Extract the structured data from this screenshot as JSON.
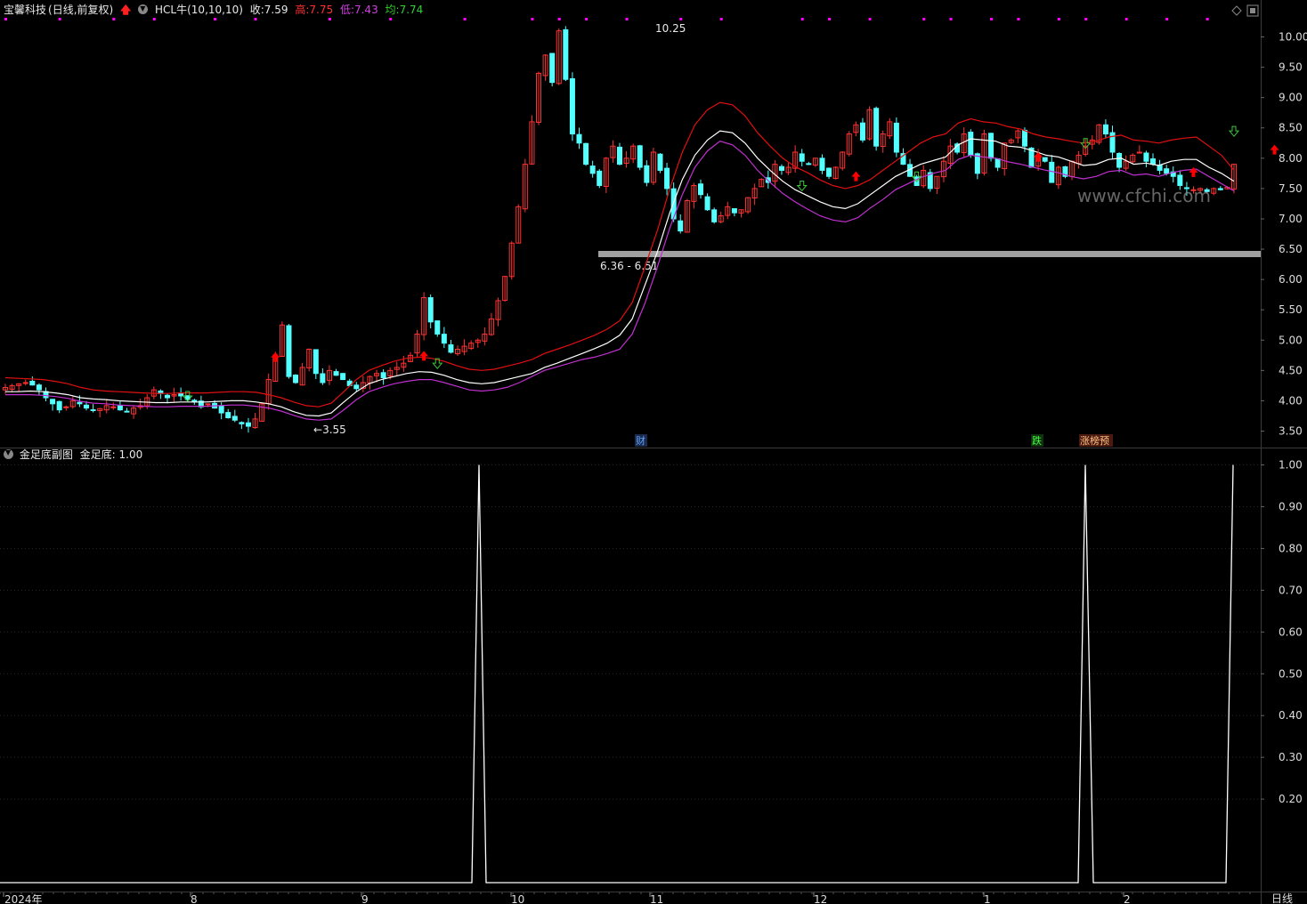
{
  "header": {
    "stock_name": "宝馨科技",
    "mode": "(日线,前复权)",
    "indicator": "HCL牛(10,10,10)",
    "close_label": "收:",
    "close_value": "7.59",
    "high_label": "高:",
    "high_value": "7.75",
    "low_label": "低:",
    "low_value": "7.43",
    "avg_label": "均:",
    "avg_value": "7.74"
  },
  "price_axis": [
    "10.00",
    "9.50",
    "9.00",
    "8.50",
    "8.00",
    "7.50",
    "7.00",
    "6.50",
    "6.00",
    "5.50",
    "5.00",
    "4.50",
    "4.00",
    "3.50"
  ],
  "sub_axis": [
    "1.00",
    "0.90",
    "0.80",
    "0.70",
    "0.60",
    "0.50",
    "0.40",
    "0.30",
    "0.20"
  ],
  "annotations": {
    "peak": "10.25",
    "trough": "3.55",
    "gap_range": "6.36 - 6.51",
    "watermark": "www.cfchi.com",
    "event_cai": "财",
    "event_die": "跌",
    "event_zhang": "涨榜预"
  },
  "sub_header": {
    "title": "金足底副图",
    "value_label": "金足底: 1.00"
  },
  "x_axis": [
    "2024年",
    "8",
    "9",
    "10",
    "11",
    "12",
    "1",
    "2"
  ],
  "period_label": "日线",
  "colors": {
    "up": "#ff3232",
    "down": "#54ffff",
    "ma_white": "#ffffff",
    "ma_red": "#e01010",
    "ma_purple": "#c030d0",
    "signal_dot": "#ff00ff",
    "buy_arrow": "#ff0000",
    "sell_arrow": "#3cc83c"
  },
  "chart_data": [
    {
      "type": "candlestick",
      "title": "宝馨科技 (日线,前复权)",
      "ylim": [
        3.3,
        10.35
      ],
      "y_ticks": [
        3.5,
        4.0,
        4.5,
        5.0,
        5.5,
        6.0,
        6.5,
        7.0,
        7.5,
        8.0,
        8.5,
        9.0,
        9.5,
        10.0
      ],
      "x_ticks": [
        "2024年",
        "8",
        "9",
        "10",
        "11",
        "12",
        "1",
        "2"
      ],
      "marked_high": 10.25,
      "marked_low": 3.55,
      "gap_zone": [
        6.36,
        6.51
      ],
      "last_bar": {
        "close": 7.59,
        "high": 7.75,
        "low": 7.43
      },
      "series": [
        {
          "name": "close",
          "values": [
            4.22,
            4.25,
            4.28,
            4.3,
            4.26,
            4.18,
            4.05,
            3.95,
            3.85,
            3.9,
            4.0,
            3.95,
            3.88,
            3.85,
            3.87,
            3.92,
            3.9,
            3.85,
            3.82,
            3.88,
            3.92,
            4.05,
            4.18,
            4.12,
            4.05,
            4.1,
            4.08,
            4.02,
            3.98,
            3.9,
            3.95,
            3.88,
            3.8,
            3.72,
            3.68,
            3.62,
            3.58,
            3.7,
            3.95,
            4.35,
            4.75,
            5.25,
            4.4,
            4.3,
            4.55,
            4.85,
            4.45,
            4.3,
            4.5,
            4.42,
            4.35,
            4.25,
            4.2,
            4.3,
            4.4,
            4.45,
            4.38,
            4.5,
            4.55,
            4.62,
            4.75,
            5.1,
            5.7,
            5.3,
            5.1,
            4.95,
            4.8,
            4.85,
            4.9,
            4.95,
            5.0,
            5.1,
            5.35,
            5.65,
            6.05,
            6.6,
            7.2,
            7.9,
            8.6,
            9.4,
            9.7,
            9.25,
            10.1,
            9.3,
            8.4,
            8.25,
            7.9,
            7.75,
            7.55,
            8.0,
            8.2,
            7.9,
            8.0,
            8.2,
            7.85,
            7.6,
            8.1,
            7.8,
            7.5,
            7.0,
            6.8,
            7.3,
            7.55,
            7.4,
            7.15,
            6.95,
            7.05,
            7.2,
            7.1,
            7.15,
            7.35,
            7.5,
            7.65,
            7.6,
            7.9,
            7.8,
            7.85,
            8.1,
            7.95,
            7.9,
            8.0,
            7.8,
            7.7,
            7.85,
            8.1,
            8.4,
            8.55,
            8.3,
            8.8,
            8.2,
            8.4,
            8.6,
            8.1,
            7.9,
            7.7,
            7.55,
            7.8,
            7.5,
            7.7,
            7.95,
            8.2,
            8.1,
            8.4,
            8.05,
            7.75,
            8.4,
            8.0,
            7.85,
            8.25,
            8.3,
            8.45,
            8.2,
            7.85,
            8.05,
            7.95,
            7.6,
            7.85,
            7.7,
            7.95,
            8.05,
            8.2,
            8.3,
            8.55,
            8.4,
            8.1,
            7.85,
            7.95,
            8.05,
            8.1,
            7.95,
            7.9,
            7.8,
            7.75,
            7.7,
            7.55,
            7.5,
            7.48,
            7.5,
            7.45,
            7.5,
            7.48,
            7.52,
            7.9
          ]
        },
        {
          "name": "MA白",
          "values": [
            4.15,
            4.15,
            4.16,
            4.15,
            4.13,
            4.1,
            4.05,
            4.03,
            4.02,
            4.0,
            3.99,
            3.98,
            3.97,
            3.97,
            3.98,
            3.98,
            3.98,
            3.99,
            4.0,
            4.0,
            3.98,
            3.95,
            3.9,
            3.82,
            3.76,
            3.75,
            3.8,
            3.98,
            4.15,
            4.28,
            4.35,
            4.4,
            4.45,
            4.48,
            4.47,
            4.42,
            4.35,
            4.3,
            4.28,
            4.3,
            4.35,
            4.4,
            4.45,
            4.55,
            4.62,
            4.7,
            4.78,
            4.86,
            4.95,
            5.08,
            5.35,
            5.9,
            6.45,
            7.1,
            7.65,
            8.05,
            8.3,
            8.45,
            8.42,
            8.25,
            8.0,
            7.8,
            7.62,
            7.48,
            7.38,
            7.28,
            7.2,
            7.17,
            7.25,
            7.4,
            7.55,
            7.7,
            7.8,
            7.9,
            7.96,
            8.02,
            8.22,
            8.32,
            8.3,
            8.28,
            8.2,
            8.18,
            8.12,
            8.05,
            8.02,
            7.95,
            7.88,
            7.9,
            7.98,
            8.0,
            7.9,
            7.92,
            7.88,
            7.95,
            7.98,
            7.98,
            7.85,
            7.75,
            7.62
          ]
        },
        {
          "name": "MA红",
          "values": [
            4.38,
            4.37,
            4.36,
            4.35,
            4.32,
            4.28,
            4.22,
            4.18,
            4.16,
            4.15,
            4.14,
            4.13,
            4.12,
            4.12,
            4.13,
            4.13,
            4.13,
            4.14,
            4.15,
            4.15,
            4.14,
            4.1,
            4.05,
            3.98,
            3.92,
            3.9,
            3.96,
            4.15,
            4.35,
            4.5,
            4.58,
            4.65,
            4.7,
            4.72,
            4.7,
            4.65,
            4.58,
            4.52,
            4.5,
            4.52,
            4.57,
            4.62,
            4.68,
            4.78,
            4.85,
            4.92,
            5.0,
            5.08,
            5.18,
            5.32,
            5.62,
            6.2,
            6.8,
            7.5,
            8.1,
            8.55,
            8.8,
            8.92,
            8.88,
            8.7,
            8.42,
            8.2,
            8.0,
            7.86,
            7.76,
            7.64,
            7.55,
            7.5,
            7.55,
            7.65,
            7.8,
            7.95,
            8.1,
            8.25,
            8.35,
            8.4,
            8.58,
            8.65,
            8.6,
            8.58,
            8.52,
            8.48,
            8.4,
            8.35,
            8.32,
            8.28,
            8.25,
            8.28,
            8.35,
            8.38,
            8.3,
            8.28,
            8.25,
            8.3,
            8.33,
            8.35,
            8.2,
            8.05,
            7.8
          ]
        },
        {
          "name": "MA紫",
          "values": [
            4.1,
            4.1,
            4.1,
            4.09,
            4.07,
            4.04,
            3.99,
            3.96,
            3.95,
            3.93,
            3.92,
            3.91,
            3.9,
            3.9,
            3.91,
            3.91,
            3.91,
            3.92,
            3.93,
            3.93,
            3.91,
            3.88,
            3.83,
            3.76,
            3.7,
            3.68,
            3.7,
            3.85,
            4.02,
            4.15,
            4.22,
            4.28,
            4.32,
            4.35,
            4.35,
            4.3,
            4.24,
            4.18,
            4.16,
            4.18,
            4.22,
            4.3,
            4.4,
            4.5,
            4.56,
            4.62,
            4.68,
            4.72,
            4.78,
            4.85,
            5.1,
            5.6,
            6.2,
            6.85,
            7.4,
            7.85,
            8.12,
            8.28,
            8.22,
            8.05,
            7.8,
            7.6,
            7.42,
            7.28,
            7.16,
            7.05,
            6.98,
            6.95,
            7.02,
            7.18,
            7.32,
            7.48,
            7.58,
            7.68,
            7.75,
            7.8,
            7.98,
            8.05,
            8.02,
            8.0,
            7.94,
            7.9,
            7.85,
            7.8,
            7.76,
            7.7,
            7.66,
            7.7,
            7.78,
            7.8,
            7.72,
            7.74,
            7.7,
            7.76,
            7.8,
            7.82,
            7.7,
            7.58,
            7.46
          ]
        }
      ]
    },
    {
      "type": "line",
      "title": "金足底副图",
      "ylim": [
        0,
        1.0
      ],
      "y_ticks": [
        0.2,
        0.3,
        0.4,
        0.5,
        0.6,
        0.7,
        0.8,
        0.9,
        1.0
      ],
      "series": [
        {
          "name": "金足底",
          "values": [
            0,
            0,
            0,
            0,
            0,
            0,
            0,
            0,
            0,
            0,
            0,
            0,
            0,
            0,
            0,
            0,
            0,
            0,
            0,
            0,
            0,
            0,
            0,
            0,
            0,
            0,
            0,
            0,
            0,
            0,
            0,
            0,
            0,
            0,
            0,
            0,
            0,
            0,
            0,
            0,
            0,
            0,
            0,
            0,
            0,
            0,
            0,
            0,
            0,
            0,
            0,
            0,
            0,
            0,
            0,
            0,
            0,
            0,
            0,
            0,
            0,
            0,
            0,
            0,
            0,
            0,
            0,
            0,
            0,
            0,
            0,
            0,
            0,
            0,
            0,
            0,
            0,
            0,
            0,
            0,
            0,
            0,
            0,
            0,
            0,
            0,
            0,
            0,
            0,
            0,
            0,
            0,
            0,
            0,
            0,
            0,
            0,
            0,
            0,
            0,
            0,
            0,
            0,
            0,
            0,
            0,
            0,
            0,
            0,
            0,
            0,
            0,
            0,
            0,
            0,
            0,
            0,
            0,
            0,
            0,
            0,
            0,
            0,
            0,
            0,
            0,
            0,
            0,
            0,
            0,
            0,
            0,
            0,
            0,
            0,
            0,
            0,
            0,
            0,
            0,
            0,
            0,
            0,
            0,
            0,
            0,
            0,
            0,
            0,
            0,
            0,
            0,
            0,
            0,
            0,
            0,
            0,
            0,
            0,
            0,
            0,
            0,
            0,
            0,
            0,
            0,
            0,
            0,
            0,
            0,
            0,
            0,
            0,
            0,
            0,
            0,
            0,
            0,
            0,
            0,
            0,
            0,
            0,
            0,
            0,
            0,
            0,
            0,
            1
          ]
        }
      ],
      "spikes_at_index": [
        60,
        157,
        196
      ]
    }
  ]
}
